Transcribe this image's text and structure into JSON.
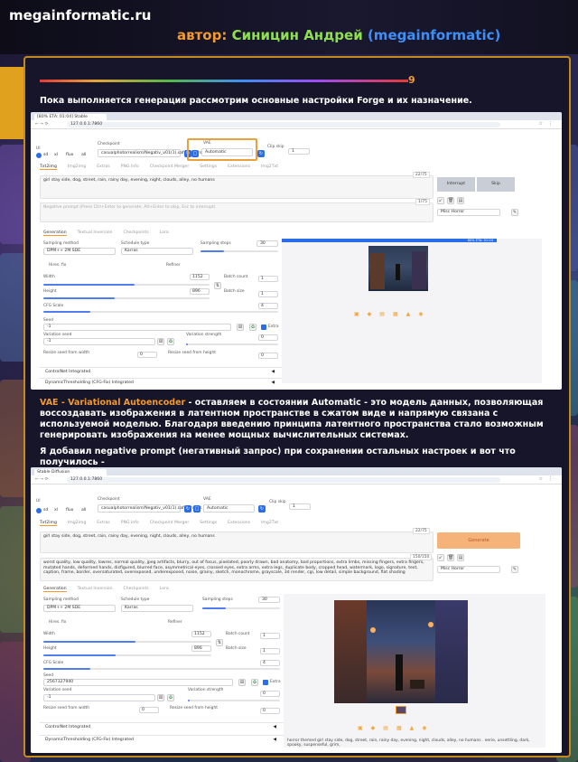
{
  "site_name": "megainformatic.ru",
  "author": {
    "label": "автор:",
    "name": "Синицин Андрей",
    "nick": "(megainformatic)"
  },
  "section_number": "9",
  "paragraph1": "Пока выполняется генерация рассмотрим основные настройки Forge и их назначение.",
  "vae_term": "VAE - Variational Autoencoder",
  "vae_desc": " - оставляем в состоянии Automatic - это модель данных, позволяющая воссоздавать изображения в латентном пространстве в сжатом виде и напрямую связана с используемой моделью. Благодаря введению принципа латентного пространства стало возможным генерировать изображения на менее мощных вычислительных системах.",
  "paragraph3": "Я добавил negative prompt (негативный запрос) при сохранении остальных настроек и вот что получилось -",
  "colors": {
    "accent": "#f29a2e",
    "green": "#8ee04e",
    "blue": "#3f8ef5",
    "frame": "#c48a1e"
  },
  "shot1": {
    "tab_title": "[80% ETA: 01:04] Stable Diffusion",
    "url": "127.0.0.1:7860",
    "ui_label": "UI",
    "ui_options": [
      "sd",
      "xl",
      "flux",
      "all"
    ],
    "checkpoint_label": "Checkpoint",
    "checkpoint_value": "casualphotorrealism/Negativ_v01(1).safetensors",
    "vae_label": "VAE",
    "vae_value": "Automatic",
    "clip_label": "Clip skip",
    "clip_value": "1",
    "tabs": [
      "Txt2img",
      "Img2img",
      "Extras",
      "PNG Info",
      "Checkpoint Merger",
      "Settings",
      "Extensions",
      "Img2Txt"
    ],
    "prompt": "girl stay side, dog, street, rain, rainy day, evening, night, clouds, alley, no humans",
    "prompt_count": "22/75",
    "negative_placeholder": "Negative prompt (Press Ctrl+Enter to generate, Alt+Enter to skip, Esc to interrupt)",
    "negative_count": "1/75",
    "interrupt": "Interrupt",
    "skip": "Skip",
    "styles_value": "Misc Horror",
    "subtabs": [
      "Generation",
      "Textual Inversion",
      "Checkpoints",
      "Lora"
    ],
    "sampling_method_label": "Sampling method",
    "sampling_method": "DPM++ 2M SDE",
    "schedule_label": "Schedule type",
    "schedule": "Karras",
    "steps_label": "Sampling steps",
    "steps": "30",
    "hires": "Hires. fix",
    "refiner": "Refiner",
    "width_label": "Width",
    "width": "1152",
    "height_label": "Height",
    "height": "896",
    "batch_count_label": "Batch count",
    "batch_count": "1",
    "batch_size_label": "Batch size",
    "batch_size": "1",
    "cfg_label": "CFG Scale",
    "cfg": "4",
    "seed_label": "Seed",
    "seed": "-1",
    "extra": "Extra",
    "var_seed_label": "Variation seed",
    "var_seed": "-1",
    "var_strength_label": "Variation strength",
    "var_strength": "0",
    "resize_w_label": "Resize seed from width",
    "resize_w": "0",
    "resize_h_label": "Resize seed from height",
    "resize_h": "0",
    "controlnet": "ControlNet Integrated",
    "dynthres": "DynamicThresholding (CFG-Fix) Integrated",
    "progress": "80% ETA: 01:04"
  },
  "shot2": {
    "tab_title": "Stable Diffusion",
    "url": "127.0.0.1:7860",
    "prompt": "girl stay side, dog, street, rain, rainy day, evening, night, clouds, alley, no humans",
    "prompt_count": "22/75",
    "negative": "worst quality, low quality, lowres, normal quality, jpeg artifacts, blurry, out of focus, pixelated, poorly drawn, bad anatomy, bad proportions, extra limbs, missing fingers, extra fingers, mutated hands, deformed hands, disfigured, blurred face, asymmetrical eyes, crossed eyes, extra arms, extra legs, duplicate body, cropped head, watermark, logo, signature, text, caption, frame, border, oversaturated, overexposed, underexposed, noise, grainy, sketch, monochrome, grayscale, 3d render, cgi, low detail, simple background, flat shading",
    "negative_count": "150/150",
    "generate": "Generate",
    "seed": "2567327940",
    "caption": "horror themed girl stay side, dog, street, rain, rainy day, evening, night, clouds, alley, no humans . eerie, unsettling, dark, spooky, suspenseful, grim,"
  }
}
